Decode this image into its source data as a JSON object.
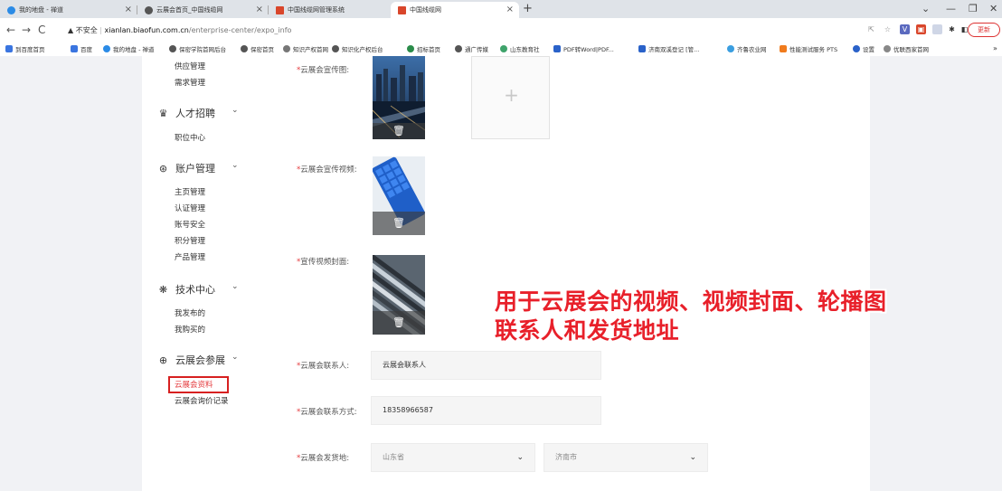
{
  "browser": {
    "tabs": [
      {
        "title": "我的地盘 - 禅道",
        "fav_color": "#2b8be6"
      },
      {
        "title": "云展会首页_中国线缆网",
        "fav_color": "#555555"
      },
      {
        "title": "中国线缆网管理系统",
        "fav_color": "#d9462b"
      },
      {
        "title": "中国线缆网",
        "fav_color": "#d9462b"
      }
    ],
    "new_tab_label": "+",
    "url": {
      "security": "不安全",
      "host": "xianlan.biaofun.com.cn",
      "path": "/enterprise-center/expo_info"
    },
    "update_label": "更新",
    "bookmarks": [
      "到百度首页",
      "百度",
      "我的地盘 - 禅道",
      "保密学院首网后台",
      "保密首页",
      "知识产权首网",
      "知识化产权后台",
      "招标首页",
      "通广传媒",
      "山东教育社",
      "PDF转Word|PDF...",
      "济南双溪登记 [管...",
      "齐鲁农业网",
      "性能测试服务 PTS",
      "设置",
      "优联西家首网"
    ]
  },
  "sidebar": {
    "sub_top": [
      "供应管理",
      "需求管理"
    ],
    "groups": [
      {
        "label": "人才招聘",
        "icon": "talent-icon",
        "items": [
          "职位中心"
        ]
      },
      {
        "label": "账户管理",
        "icon": "account-icon",
        "items": [
          "主页管理",
          "认证管理",
          "账号安全",
          "积分管理",
          "产品管理"
        ]
      },
      {
        "label": "技术中心",
        "icon": "tech-icon",
        "items": [
          "我发布的",
          "我购买的"
        ]
      },
      {
        "label": "云展会参展",
        "icon": "expo-icon",
        "items": [
          "云展会资料",
          "云展会询价记录"
        ]
      }
    ]
  },
  "form": {
    "promo_image_label": "云展会宣传图:",
    "promo_video_label": "云展会宣传视频:",
    "video_cover_label": "宣传视频封面:",
    "contact_label": "云展会联系人:",
    "contact_value": "云展会联系人",
    "phone_label": "云展会联系方式:",
    "phone_value": "18358966587",
    "ship_label": "云展会发货地:",
    "province_value": "山东省",
    "city_value": "济南市",
    "required_mark": "*"
  },
  "annotation": {
    "line1": "用于云展会的视频、视频封面、轮播图",
    "line2": "联系人和发货地址",
    "color": "#e8202a"
  }
}
